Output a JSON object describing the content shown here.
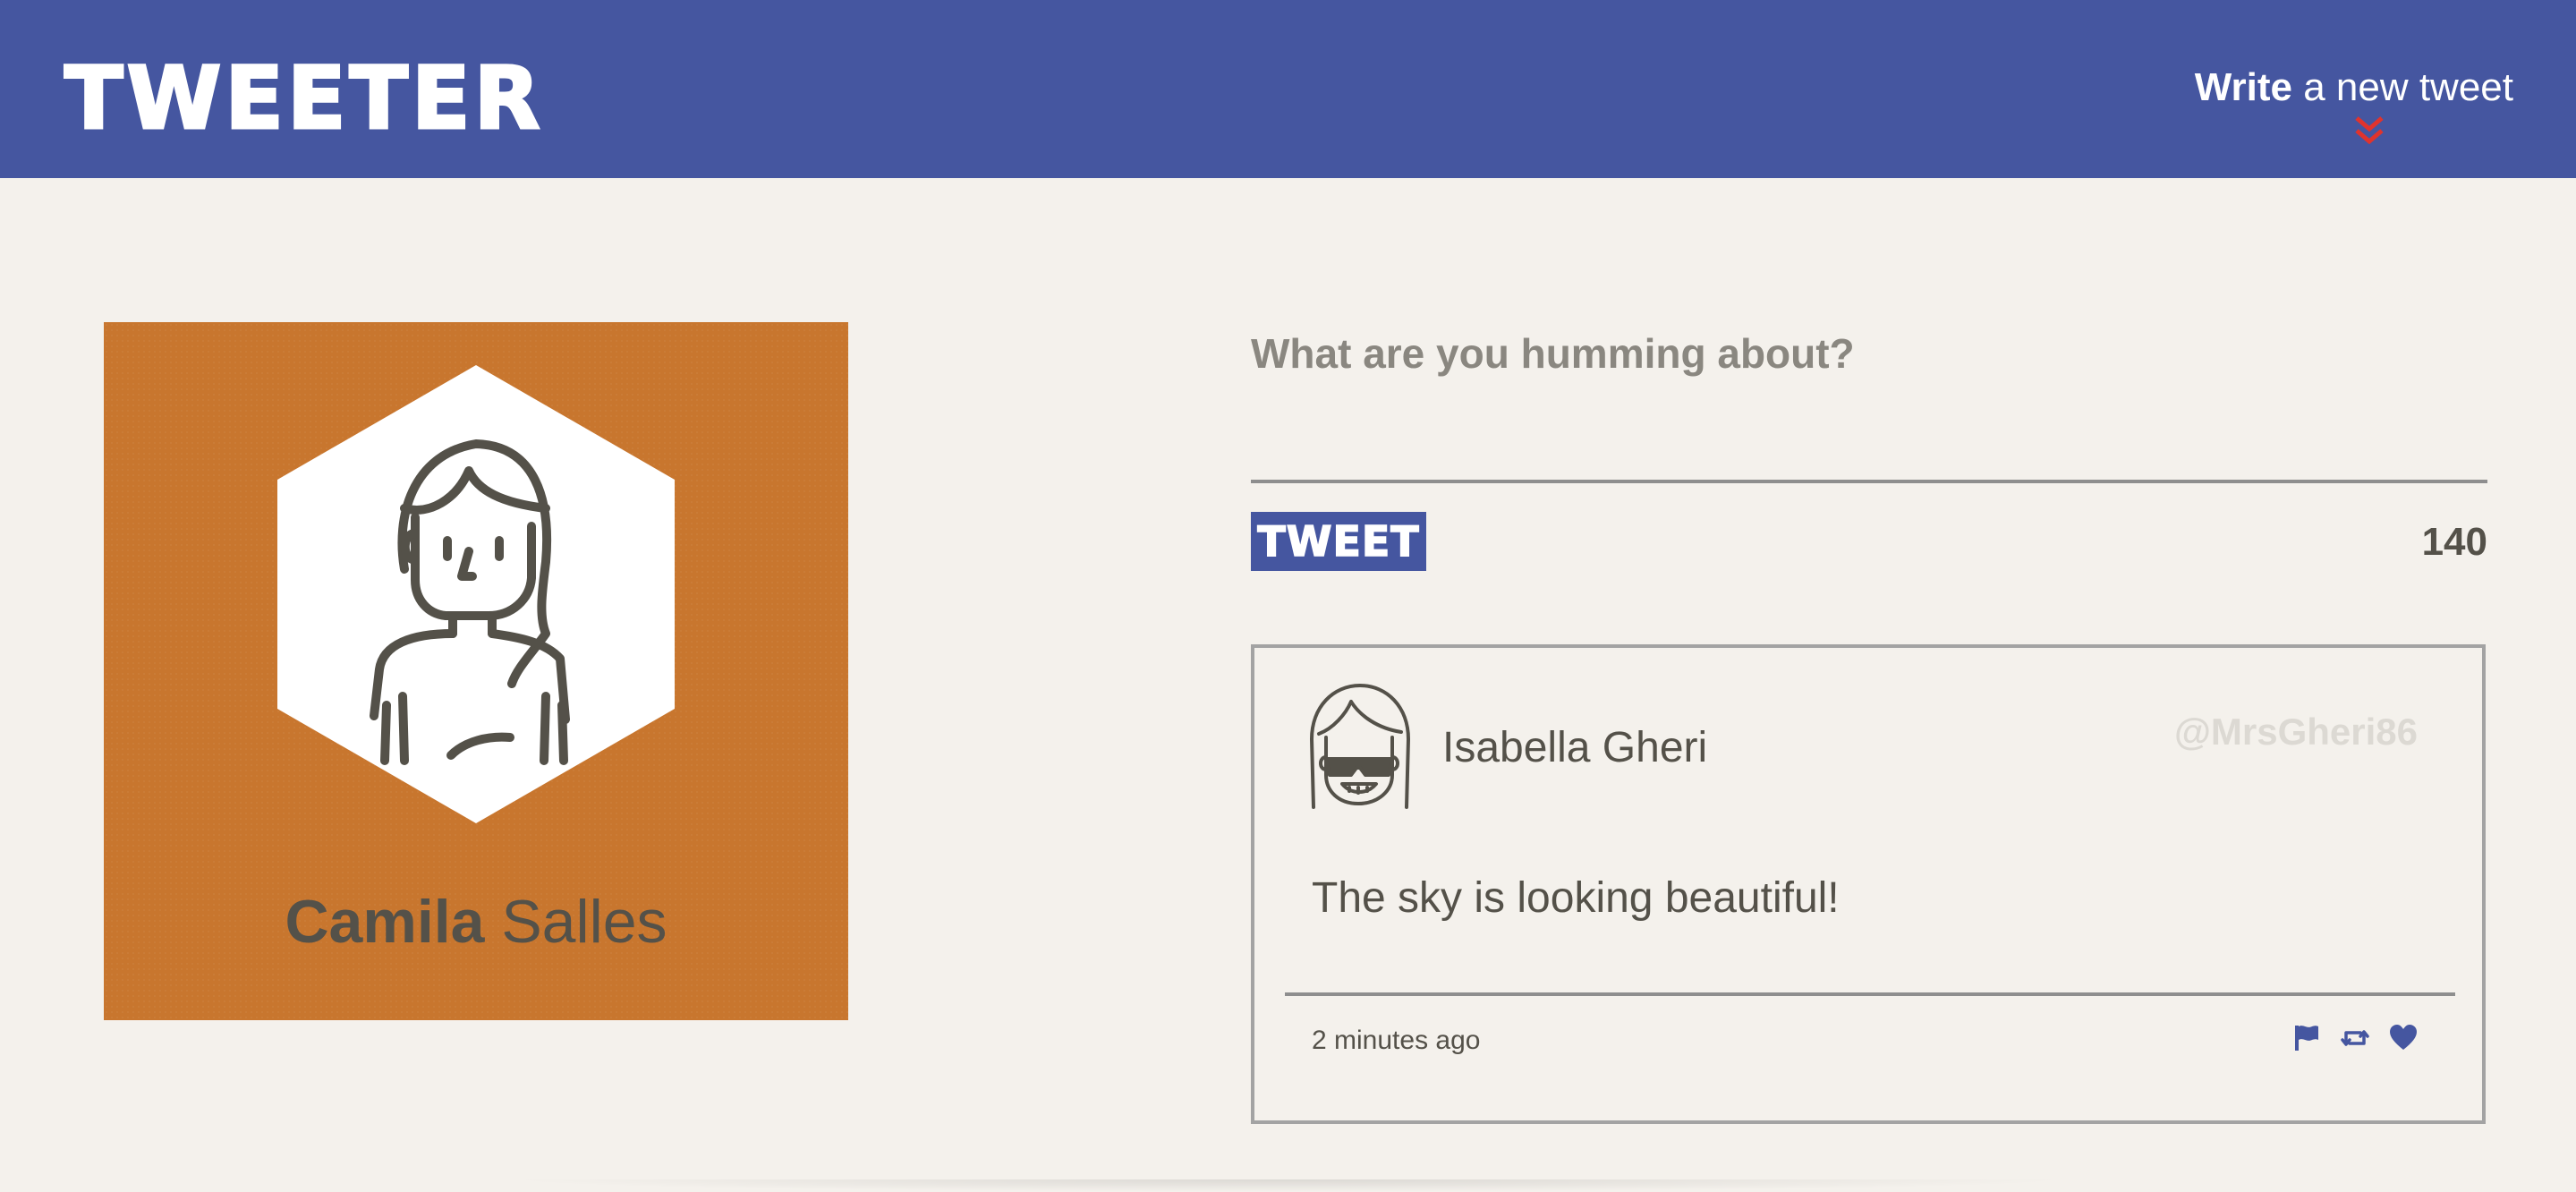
{
  "nav": {
    "brand": "TWEETER",
    "compose_bold": "Write",
    "compose_rest": " a new tweet",
    "chevron_icon": "double-chevron-down-icon",
    "colors": {
      "nav_bg": "#4556a0",
      "chevron": "#e0332d"
    }
  },
  "profile": {
    "first_name": "Camila",
    "last_name": " Salles",
    "avatar_icon": "person-long-hair-avatar",
    "card_color": "#c8762e"
  },
  "composer": {
    "placeholder": "What are you humming about?",
    "value": "",
    "submit_label": "TWEET",
    "char_counter": "140"
  },
  "tweet": {
    "author_name": "Isabella Gheri",
    "handle": "@MrsGheri86",
    "avatar_icon": "person-sunglasses-avatar",
    "body": "The sky is looking beautiful!",
    "time_ago": "2 minutes ago",
    "actions": [
      {
        "name": "flag-icon"
      },
      {
        "name": "retweet-icon"
      },
      {
        "name": "heart-icon"
      }
    ]
  }
}
